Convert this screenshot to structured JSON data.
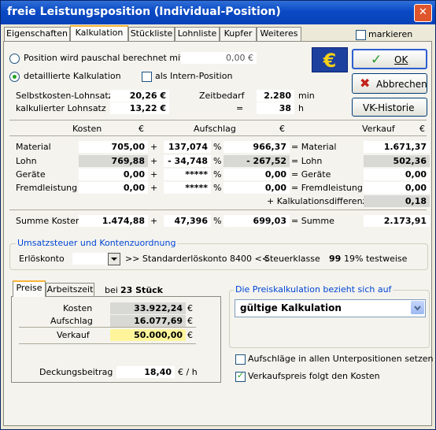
{
  "window": {
    "title": "freie Leistungsposition  (Individual-Position)",
    "close": "✕"
  },
  "tabs": [
    "Eigenschaften",
    "Kalkulation",
    "Stückliste",
    "Lohnliste",
    "Kupfer",
    "Weiteres"
  ],
  "markieren_label": "markieren",
  "mode": {
    "pauschal_label": "Position wird pauschal berechnet mit",
    "pauschal_value": "0,00 €",
    "detail_label": "detaillierte Kalkulation",
    "intern_label": "als Intern-Position"
  },
  "rates": {
    "selbstkosten_label": "Selbstkosten-Lohnsatz",
    "selbstkosten_value": "20,26 €",
    "kalk_label": "kalkulierter Lohnsatz",
    "kalk_value": "13,22 €",
    "zeit_label": "Zeitbedarf",
    "zeit_min": "2.280",
    "zeit_min_unit": "min",
    "eq": "=",
    "zeit_h": "38",
    "zeit_h_unit": "h"
  },
  "buttons": {
    "ok": "OK",
    "abbrechen": "Abbrechen",
    "vk_historie": "VK-Historie"
  },
  "table": {
    "headers": {
      "kosten": "Kosten",
      "eur1": "€",
      "aufschlag": "Aufschlag",
      "eur2": "€",
      "verkauf": "Verkauf",
      "eur3": "€"
    },
    "rows": [
      {
        "label": "Material",
        "kosten": "705,00",
        "op": "+",
        "aufschlag": "137,074",
        "pct": "%",
        "betrag": "966,37",
        "eq": "= Material",
        "verkauf": "1.671,37"
      },
      {
        "label": "Lohn",
        "kosten": "769,88",
        "op": "+",
        "aufschlag": "- 34,748",
        "pct": "%",
        "betrag": "- 267,52",
        "eq": "= Lohn",
        "verkauf": "502,36"
      },
      {
        "label": "Geräte",
        "kosten": "0,00",
        "op": "+",
        "aufschlag": "*****",
        "pct": "%",
        "betrag": "0,00",
        "eq": "= Geräte",
        "verkauf": "0,00"
      },
      {
        "label": "Fremdleistung",
        "kosten": "0,00",
        "op": "+",
        "aufschlag": "*****",
        "pct": "%",
        "betrag": "0,00",
        "eq": "= Fremdleistung",
        "verkauf": "0,00"
      }
    ],
    "diff_label": "+ Kalkulationsdifferenz",
    "diff_value": "0,18",
    "summe": {
      "label": "Summe Kosten",
      "kosten": "1.474,88",
      "op": "+",
      "aufschlag": "47,396",
      "pct": "%",
      "betrag": "699,03",
      "eq": "= Summe",
      "verkauf": "2.173,91"
    }
  },
  "ust": {
    "group_title": "Umsatzsteuer und Kontenzuordnung",
    "erloes_label": "Erlöskonto",
    "std_label": ">> Standarderlöskonto 8400 <<",
    "steuer_label": "Steuerklasse",
    "steuer_nr": "99",
    "steuer_text": "19% testweise"
  },
  "preise": {
    "tabs": [
      "Preise",
      "Arbeitszeit"
    ],
    "bei_label": "bei",
    "stueck": "23 Stück",
    "kosten_label": "Kosten",
    "kosten_value": "33.922,24",
    "aufschlag_label": "Aufschlag",
    "aufschlag_value": "16.077,69",
    "verkauf_label": "Verkauf",
    "verkauf_value": "50.000,00",
    "eur": "€",
    "deckung_label": "Deckungsbeitrag",
    "deckung_value": "18,40",
    "deckung_unit": "€ / h"
  },
  "preiskalk": {
    "group_title": "Die Preiskalkulation bezieht sich auf",
    "selected": "gültige Kalkulation",
    "aufschlaege_label": "Aufschläge in allen Unterpositionen setzen",
    "vkfolgt_label": "Verkaufspreis folgt den Kosten"
  }
}
